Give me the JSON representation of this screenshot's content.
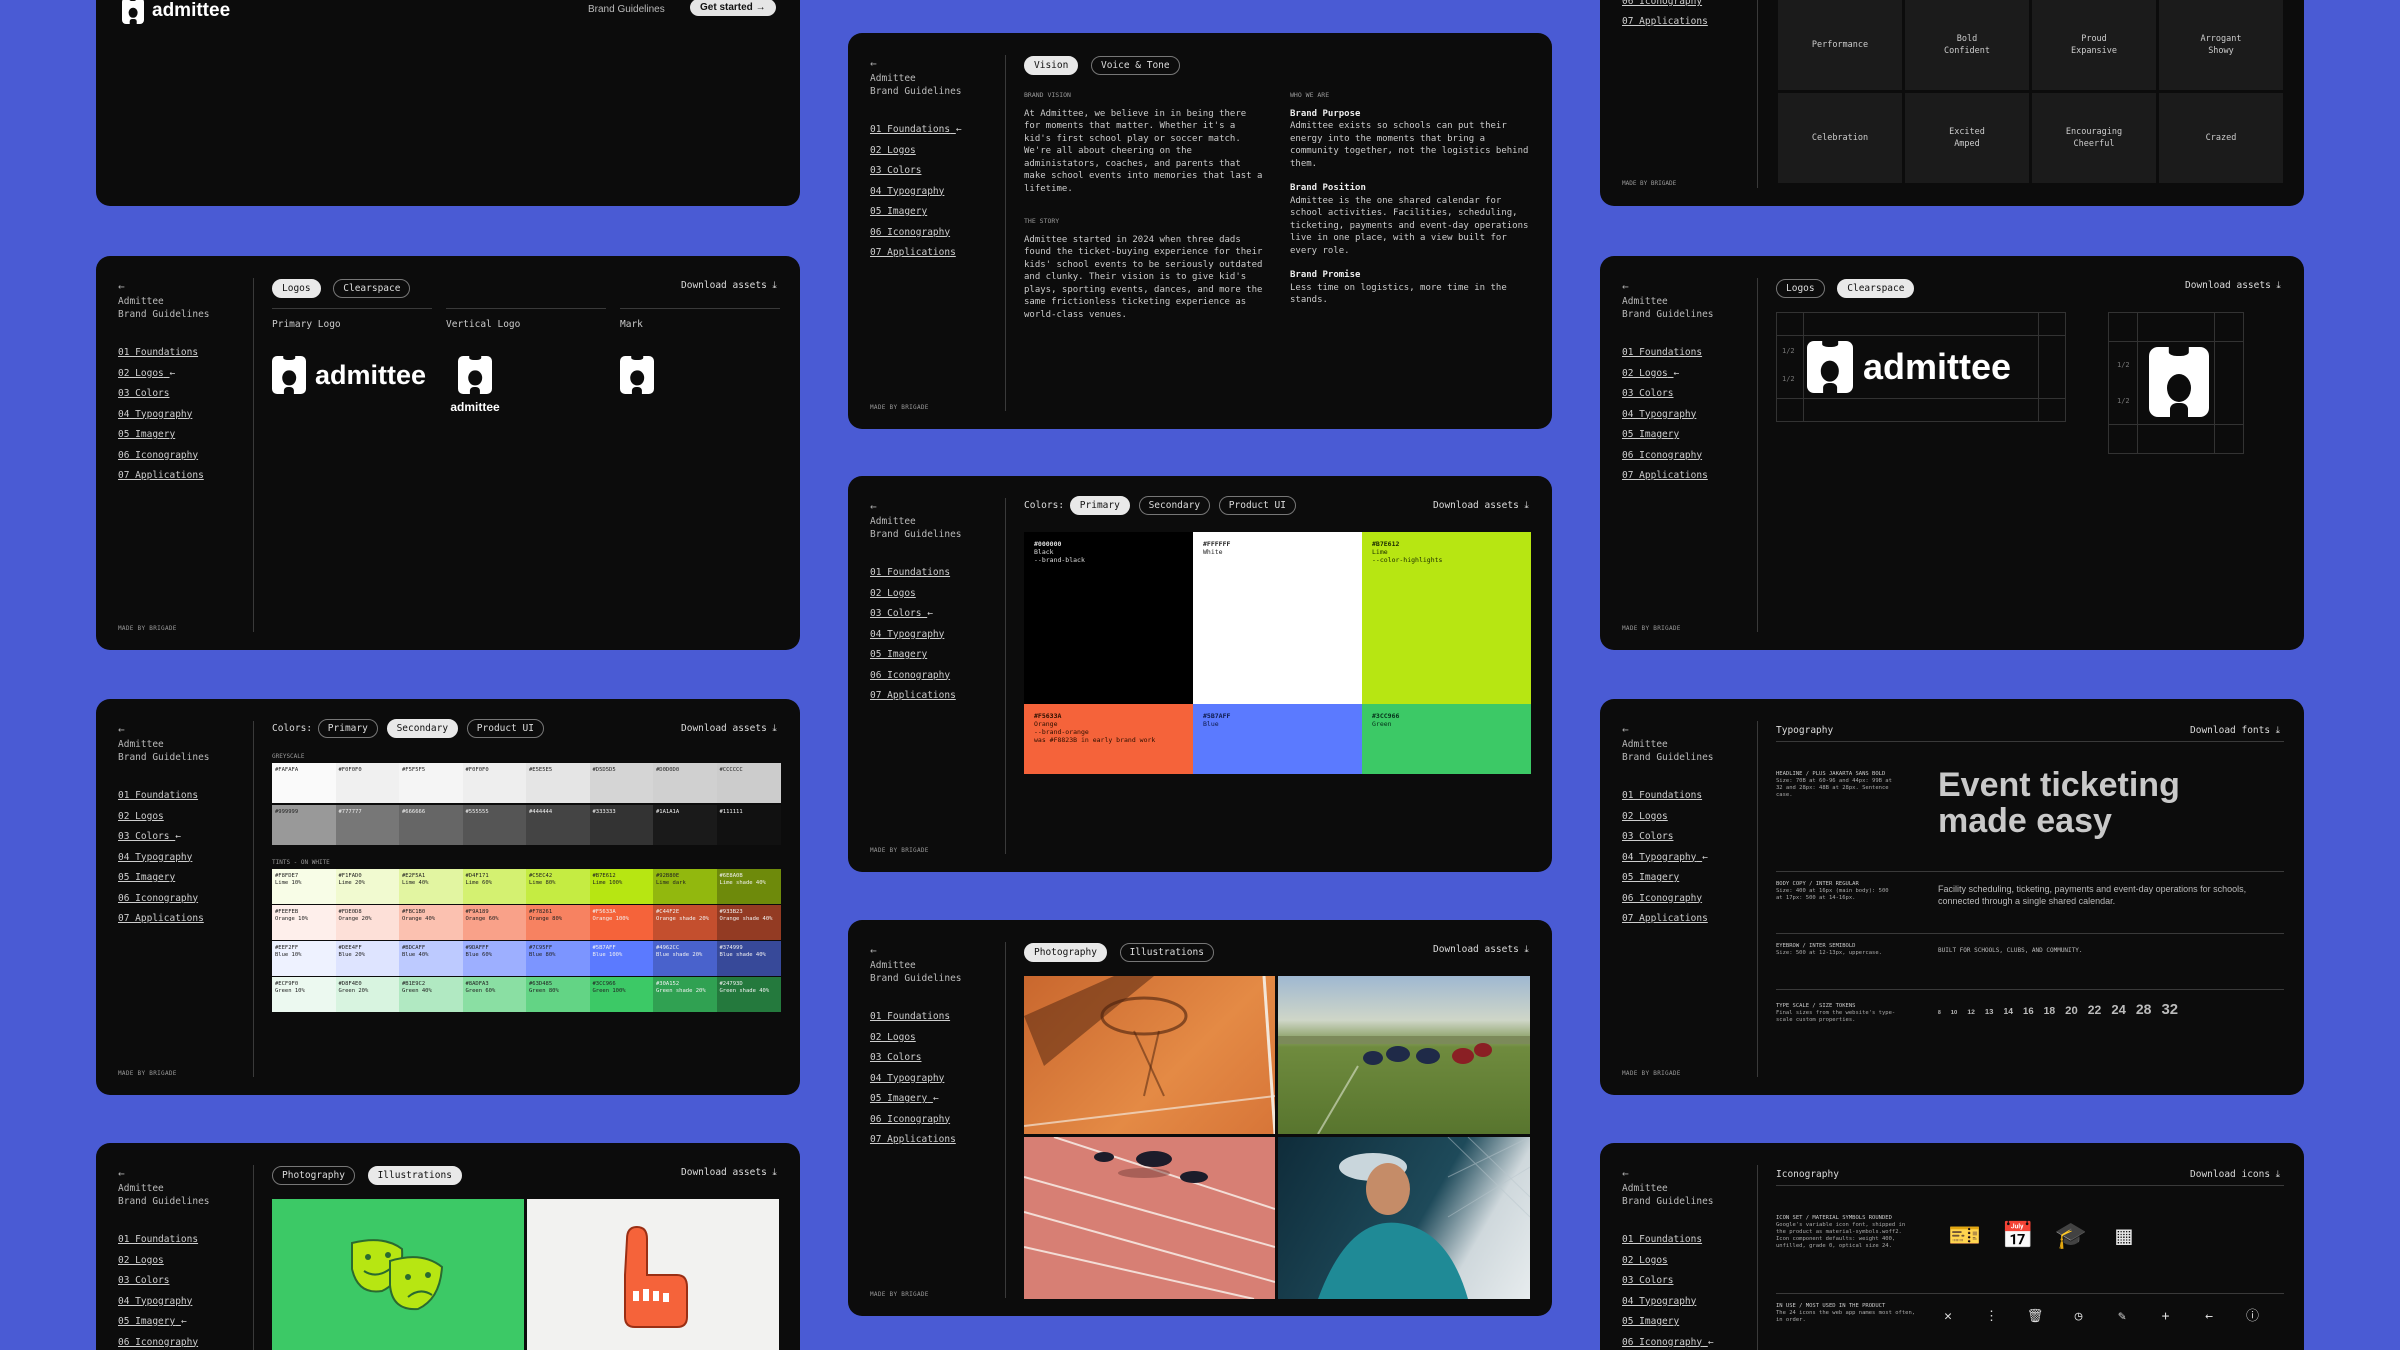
{
  "common": {
    "back": "←",
    "brand_line1": "Admittee",
    "brand_line2": "Brand Guidelines",
    "nav": [
      "01 Foundations",
      "02 Logos",
      "03 Colors",
      "04 Typography",
      "05 Imagery",
      "06 Iconography",
      "07 Applications"
    ],
    "active_arrow": "←",
    "made_by": "MADE BY BRIGADE",
    "download_assets": "Download assets ⤓"
  },
  "hero": {
    "logo_text": "admittee",
    "nav_link": "Brand Guidelines",
    "cta": "Get started →"
  },
  "foundations": {
    "tabs": [
      "Vision",
      "Voice & Tone"
    ],
    "brand_vision_heading": "BRAND VISION",
    "brand_vision_body": "At Admittee, we believe in in being there for moments that matter. Whether it's a kid's first school play or soccer match. We're all about cheering on the administators, coaches, and parents that make school events into memories that last a lifetime.",
    "story_heading": "THE STORY",
    "story_body": "Admittee started in 2024 when three dads found the ticket-buying experience for their kids' school events to be seriously outdated and clunky. Their vision is to give kid's plays, sporting events, dances, and more the same frictionless ticketing experience as world-class venues.",
    "who_heading": "WHO WE ARE",
    "purpose_title": "Brand Purpose",
    "purpose_body": "Admittee exists so schools can put their energy into the moments that bring a community together, not the logistics behind them.",
    "position_title": "Brand Position",
    "position_body": "Admittee is the one shared calendar for school activities. Facilities, scheduling, ticketing, payments and event-day operations live in one place, with a view built for every role.",
    "promise_title": "Brand Promise",
    "promise_body": "Less time on logistics, more time in the stands."
  },
  "voice_grid": {
    "row1": [
      "Performance",
      "Bold\nConfident",
      "Proud\nExpansive",
      "Arrogant\nShowy"
    ],
    "row2": [
      "Celebration",
      "Excited\nAmped",
      "Encouraging\nCheerful",
      "Crazed"
    ]
  },
  "logos": {
    "tabs": [
      "Logos",
      "Clearspace"
    ],
    "primary_label": "Primary Logo",
    "vertical_label": "Vertical Logo",
    "mark_label": "Mark",
    "wordmark": "admittee",
    "clear_labels": [
      "1/2",
      "1/2"
    ]
  },
  "colors_primary": {
    "prefix": "Colors:",
    "tabs": [
      "Primary",
      "Secondary",
      "Product UI"
    ],
    "swatches": [
      {
        "hex": "#000000",
        "name": "Black",
        "token": "--brand-black",
        "bg": "#000000",
        "fg": "#dddddd"
      },
      {
        "hex": "#FFFFFF",
        "name": "White",
        "token": "",
        "bg": "#ffffff",
        "fg": "#222222"
      },
      {
        "hex": "#B7E612",
        "name": "Lime",
        "token": "--color-highlights",
        "bg": "#B7E612",
        "fg": "#1a2a00"
      },
      {
        "hex": "#F5633A",
        "name": "Orange",
        "token": "--brand-orange\nwas #F8823B in early brand work",
        "bg": "#F5633A",
        "fg": "#2a0f00"
      },
      {
        "hex": "#5B7AFF",
        "name": "Blue",
        "token": "",
        "bg": "#5B7AFF",
        "fg": "#0e1a4a"
      },
      {
        "hex": "#3CC966",
        "name": "Green",
        "token": "",
        "bg": "#3CC966",
        "fg": "#06301a"
      }
    ]
  },
  "colors_secondary": {
    "prefix": "Colors:",
    "tabs": [
      "Primary",
      "Secondary",
      "Product UI"
    ],
    "greyscale_label": "GREYSCALE",
    "grey_row1": [
      {
        "hex": "#FAFAFA",
        "bg": "#FAFAFA"
      },
      {
        "hex": "#F0F0F0",
        "bg": "#F0F0F0"
      },
      {
        "hex": "#F5F5F5",
        "bg": "#F5F5F5"
      },
      {
        "hex": "#F0F0F0",
        "bg": "#EEEEEE"
      },
      {
        "hex": "#E5E5E5",
        "bg": "#E5E5E5"
      },
      {
        "hex": "#D5D5D5",
        "bg": "#D5D5D5"
      },
      {
        "hex": "#D0D0D0",
        "bg": "#D0D0D0"
      },
      {
        "hex": "#CCCCCC",
        "bg": "#CCCCCC"
      }
    ],
    "grey_row2": [
      {
        "hex": "#999999",
        "bg": "#999999"
      },
      {
        "hex": "#777777",
        "bg": "#777777"
      },
      {
        "hex": "#666666",
        "bg": "#666666"
      },
      {
        "hex": "#555555",
        "bg": "#555555"
      },
      {
        "hex": "#444444",
        "bg": "#444444"
      },
      {
        "hex": "#333333",
        "bg": "#333333"
      },
      {
        "hex": "#1A1A1A",
        "bg": "#1A1A1A"
      },
      {
        "hex": "#111111",
        "bg": "#111111"
      }
    ],
    "tints_label": "TINTS - ON WHITE",
    "tints": [
      [
        {
          "t": "#F8FDE7\nLime 10%",
          "bg": "#F8FDE7"
        },
        {
          "t": "#F1FAD0\nLime 20%",
          "bg": "#F1FAD0"
        },
        {
          "t": "#E2F5A1\nLime 40%",
          "bg": "#E2F5A1"
        },
        {
          "t": "#D4F171\nLime 60%",
          "bg": "#D4F171"
        },
        {
          "t": "#C5EC42\nLime 80%",
          "bg": "#C5EC42"
        },
        {
          "t": "#B7E612\nLime 100%",
          "bg": "#B7E612"
        },
        {
          "t": "#92B80E\nLime dark",
          "bg": "#92B80E"
        },
        {
          "t": "#6E8A0B\nLime shade 40%",
          "bg": "#6E8A0B"
        }
      ],
      [
        {
          "t": "#FEEFEB\nOrange 10%",
          "bg": "#FEEFEB"
        },
        {
          "t": "#FDE0D8\nOrange 20%",
          "bg": "#FDE0D8"
        },
        {
          "t": "#FBC1B0\nOrange 40%",
          "bg": "#FBC1B0"
        },
        {
          "t": "#F9A189\nOrange 60%",
          "bg": "#F9A189"
        },
        {
          "t": "#F78261\nOrange 80%",
          "bg": "#F78261"
        },
        {
          "t": "#F5633A\nOrange 100%",
          "bg": "#F5633A"
        },
        {
          "t": "#C44F2E\nOrange shade 20%",
          "bg": "#C44F2E"
        },
        {
          "t": "#933B23\nOrange shade 40%",
          "bg": "#933B23"
        }
      ],
      [
        {
          "t": "#EEF2FF\nBlue 10%",
          "bg": "#EEF2FF"
        },
        {
          "t": "#DEE4FF\nBlue 20%",
          "bg": "#DEE4FF"
        },
        {
          "t": "#BDCAFF\nBlue 40%",
          "bg": "#BDCAFF"
        },
        {
          "t": "#9DAFFF\nBlue 60%",
          "bg": "#9DAFFF"
        },
        {
          "t": "#7C95FF\nBlue 80%",
          "bg": "#7C95FF"
        },
        {
          "t": "#5B7AFF\nBlue 100%",
          "bg": "#5B7AFF"
        },
        {
          "t": "#4962CC\nBlue shade 20%",
          "bg": "#4962CC"
        },
        {
          "t": "#374999\nBlue shade 40%",
          "bg": "#374999"
        }
      ],
      [
        {
          "t": "#ECF9F0\nGreen 10%",
          "bg": "#ECF9F0"
        },
        {
          "t": "#D8F4E0\nGreen 20%",
          "bg": "#D8F4E0"
        },
        {
          "t": "#B1E9C2\nGreen 40%",
          "bg": "#B1E9C2"
        },
        {
          "t": "#8ADFA3\nGreen 60%",
          "bg": "#8ADFA3"
        },
        {
          "t": "#63D485\nGreen 80%",
          "bg": "#63D485"
        },
        {
          "t": "#3CC966\nGreen 100%",
          "bg": "#3CC966"
        },
        {
          "t": "#30A152\nGreen shade 20%",
          "bg": "#30A152"
        },
        {
          "t": "#24793D\nGreen shade 40%",
          "bg": "#24793D"
        }
      ]
    ]
  },
  "imagery": {
    "tabs": [
      "Photography",
      "Illustrations"
    ]
  },
  "typography": {
    "title": "Typography",
    "download": "Download fonts ⤓",
    "headline_label": "HEADLINE / PLUS JAKARTA SANS BOLD",
    "headline_spec": "Size: 70B at 60-96 and 44px: 99B at 32 and 28px: 48B at 28px. Sentence case.",
    "display": "Event ticketing\nmade easy",
    "body_label": "BODY COPY / INTER REGULAR",
    "body_spec": "Size: 400 at 16px (main body): 500 at 17px: 500 at 14-16px.",
    "body_sample": "Facility scheduling, ticketing, payments and event-day operations for schools, connected through a single shared calendar.",
    "eyebrow_label": "EYEBROW / INTER SEMIBOLD",
    "eyebrow_spec": "Size: 500 at 12-13px, uppercase.",
    "eyebrow_sample": "BUILT FOR SCHOOLS, CLUBS, AND COMMUNITY.",
    "scale_label": "TYPE SCALE / SIZE TOKENS",
    "scale_spec": "Final sizes from the website's type-scale custom properties.",
    "scale": [
      "8",
      "10",
      "12",
      "13",
      "14",
      "16",
      "18",
      "20",
      "22",
      "24",
      "28",
      "32"
    ]
  },
  "iconography": {
    "title": "Iconography",
    "download": "Download icons ⤓",
    "set_label": "ICON SET / MATERIAL SYMBOLS ROUNDED",
    "set_spec": "Google's variable icon font, shipped in the product as material-symbols.woff2. Icon component defaults: weight 400, unfilled, grade 0, optical size 24.",
    "featured": [
      "🎫",
      "📅",
      "🎓",
      "▦"
    ],
    "inuse_label": "IN USE / MOST USED IN THE PRODUCT",
    "inuse_spec": "The 24 icons the web app names most often, in order.",
    "small": [
      "✕",
      "⋮",
      "🗑",
      "◷",
      "✎",
      "+",
      "←",
      "ⓘ"
    ]
  }
}
